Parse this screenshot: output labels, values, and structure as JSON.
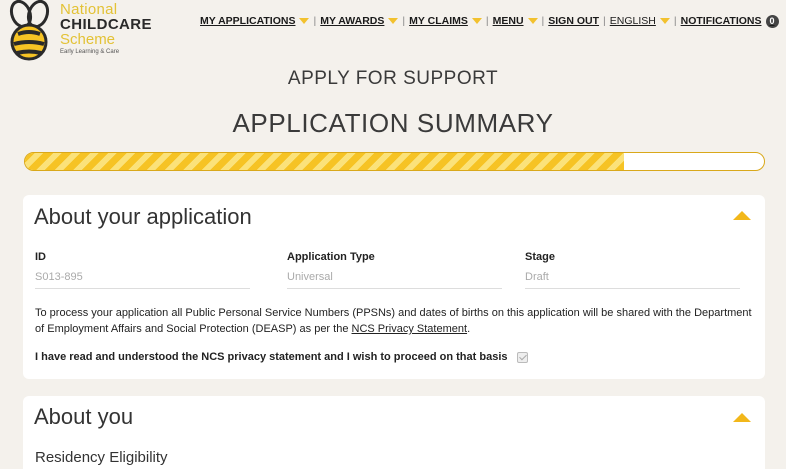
{
  "logo": {
    "line1": "National",
    "line2": "CHILDCARE",
    "line3": "Scheme",
    "line4": "Early Learning & Care"
  },
  "nav": {
    "my_applications": "MY APPLICATIONS",
    "my_awards": "MY AWARDS",
    "my_claims": "MY CLAIMS",
    "menu": "MENU",
    "sign_out": "SIGN OUT",
    "language": "ENGLISH",
    "notifications": "NOTIFICATIONS",
    "notifications_count": "0",
    "separator": "|"
  },
  "page": {
    "heading": "APPLY FOR SUPPORT",
    "subheading": "APPLICATION SUMMARY",
    "progress_fraction": 0.81
  },
  "about_application": {
    "title": "About your application",
    "fields": [
      {
        "label": "ID",
        "value": "S013-895"
      },
      {
        "label": "Application Type",
        "value": "Universal"
      },
      {
        "label": "Stage",
        "value": "Draft"
      }
    ],
    "privacy_before": "To process your application all Public Personal Service Numbers (PPSNs) and dates of births on this application will be shared with the Department of Employment Affairs and Social Protection (DEASP) as per the ",
    "privacy_link": "NCS Privacy Statement",
    "privacy_after": ".",
    "consent_label": "I have read and understood the NCS privacy statement and I wish to proceed on that basis"
  },
  "about_you": {
    "title": "About you",
    "section": "Residency Eligibility"
  },
  "colors": {
    "accent": "#f6c324",
    "background": "#f4f1ec"
  }
}
